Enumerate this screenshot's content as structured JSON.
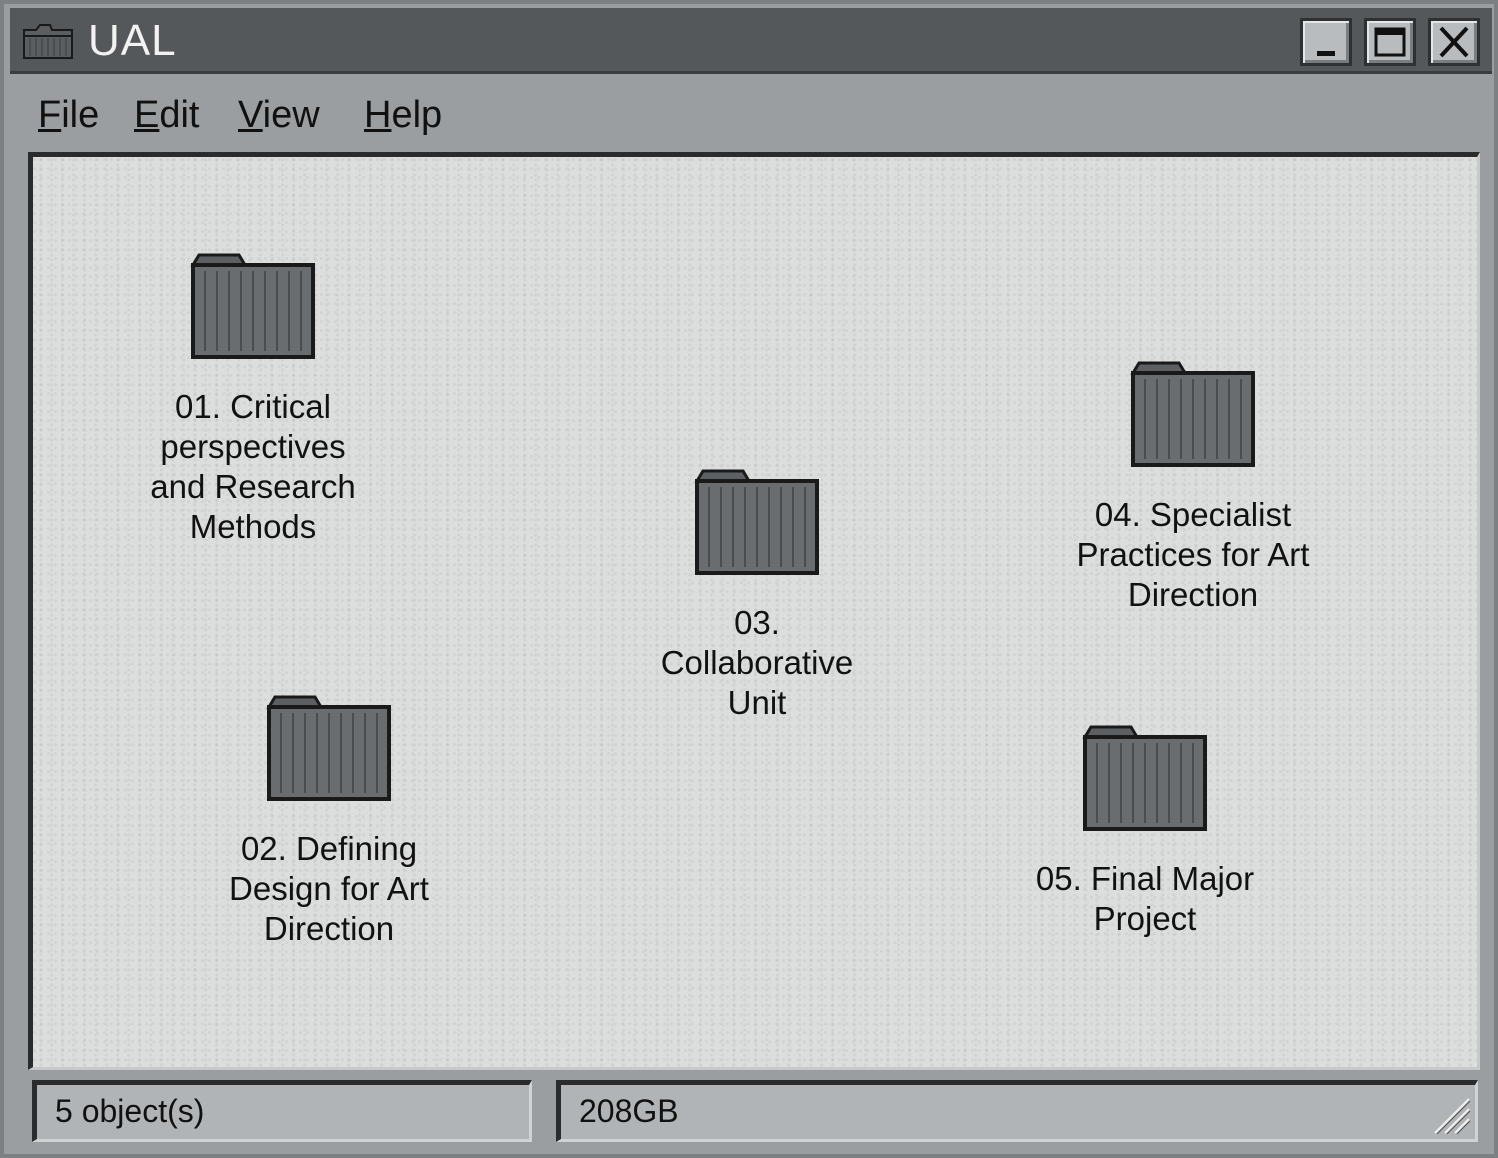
{
  "window": {
    "title": "UAL",
    "controls": {
      "minimize_icon": "minimize-icon",
      "maximize_icon": "maximize-icon",
      "close_icon": "close-icon"
    }
  },
  "menu": {
    "file": "File",
    "edit": "Edit",
    "view": "View",
    "help": "Help"
  },
  "folders": [
    {
      "label": "01. Critical perspectives and Research Methods",
      "icon": "folder-icon"
    },
    {
      "label": "02. Defining Design for Art Direction",
      "icon": "folder-icon"
    },
    {
      "label": "03. Collaborative Unit",
      "icon": "folder-icon"
    },
    {
      "label": "04. Specialist Practices for Art Direction",
      "icon": "folder-icon"
    },
    {
      "label": "05. Final Major Project",
      "icon": "folder-icon"
    }
  ],
  "status": {
    "objects": "5 object(s)",
    "size": "208GB"
  },
  "colors": {
    "titlebar": "#55585b",
    "content": "#dcdddd",
    "chrome": "#9a9ea1"
  }
}
